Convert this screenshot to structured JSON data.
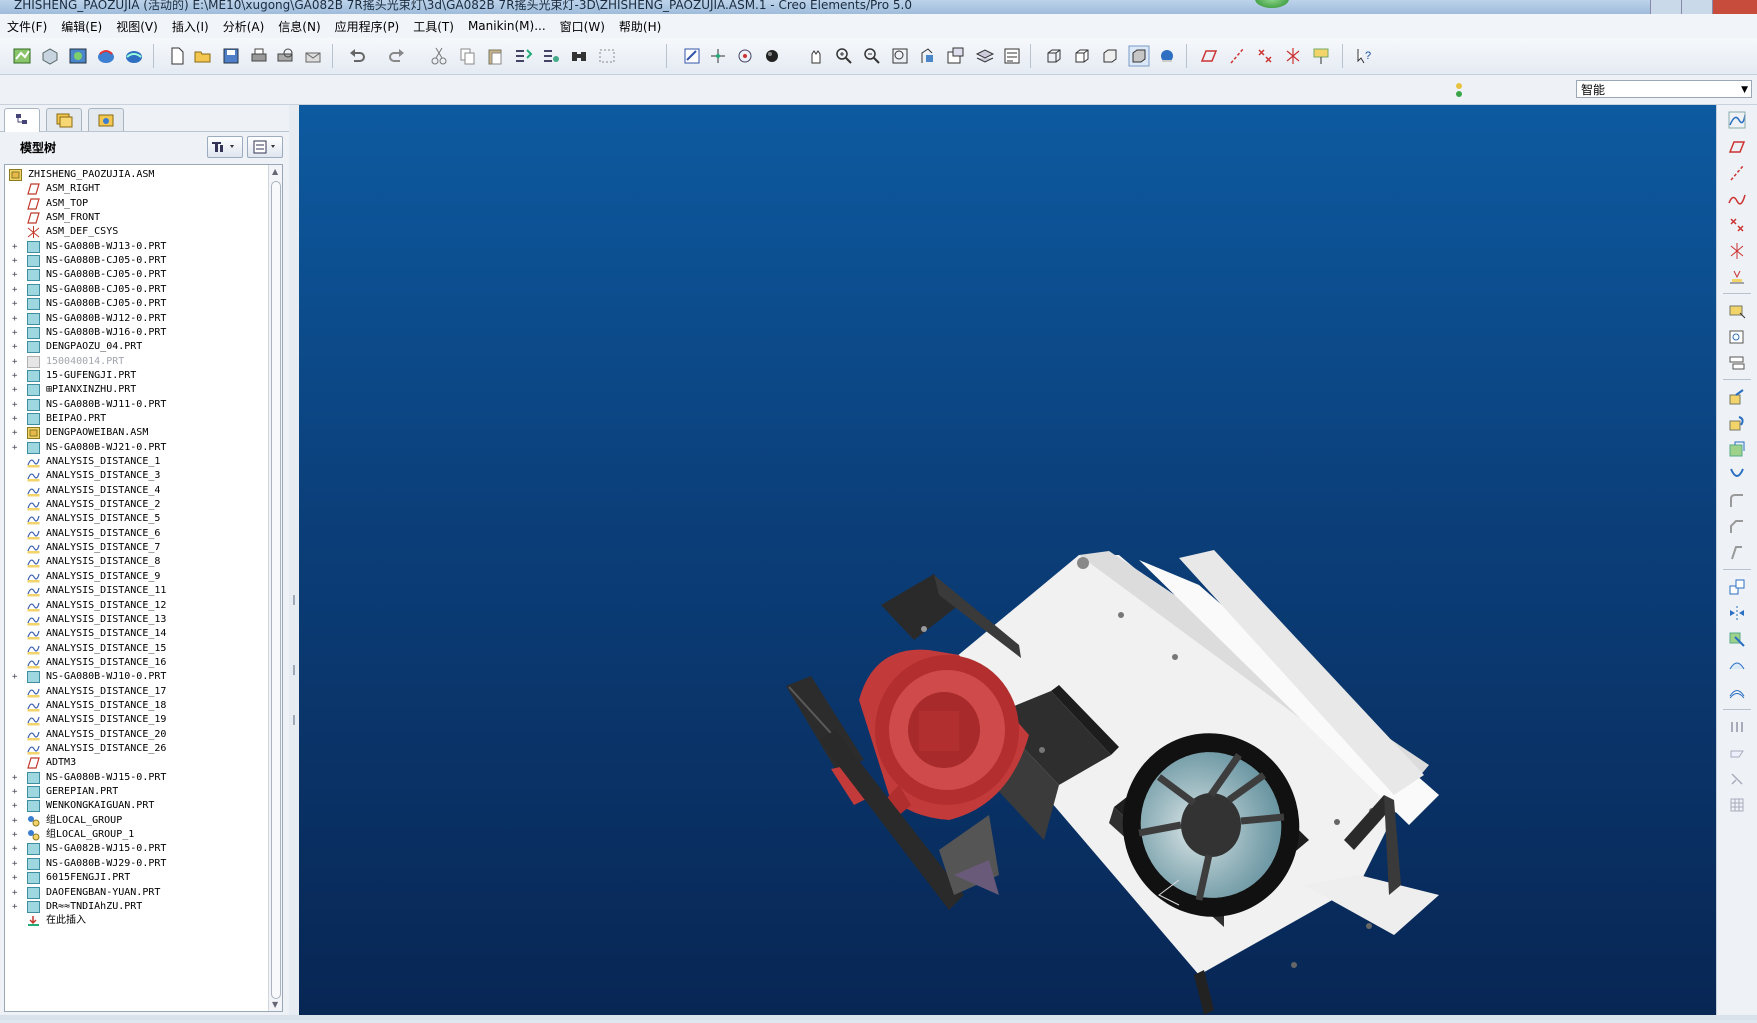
{
  "window": {
    "title": "ZHISHENG_PAOZUJIA (活动的) E:\\ME10\\xugong\\GA082B 7R搖头光束灯\\3d\\GA082B 7R搖头光束灯-3D\\ZHISHENG_PAOZUJIA.ASM.1 - Creo Elements/Pro 5.0"
  },
  "menu": {
    "items": [
      "文件(F)",
      "编辑(E)",
      "视图(V)",
      "插入(I)",
      "分析(A)",
      "信息(N)",
      "应用程序(P)",
      "工具(T)",
      "Manikin(M)...",
      "窗口(W)",
      "帮助(H)"
    ]
  },
  "toolbar2": {
    "filter_value": "智能"
  },
  "leftpanel": {
    "tree_title": "模型树"
  },
  "tree": {
    "items": [
      {
        "label": "ZHISHENG_PAOZUJIA.ASM",
        "icon": "assembly-icon",
        "expander": false,
        "root": true
      },
      {
        "label": "ASM_RIGHT",
        "icon": "datum-plane-icon",
        "expander": false
      },
      {
        "label": "ASM_TOP",
        "icon": "datum-plane-icon",
        "expander": false
      },
      {
        "label": "ASM_FRONT",
        "icon": "datum-plane-icon",
        "expander": false
      },
      {
        "label": "ASM_DEF_CSYS",
        "icon": "coordinate-system-icon",
        "expander": false
      },
      {
        "label": "NS-GA080B-WJ13-0.PRT",
        "icon": "part-icon",
        "expander": true
      },
      {
        "label": "NS-GA080B-CJ05-0.PRT",
        "icon": "part-icon",
        "expander": true
      },
      {
        "label": "NS-GA080B-CJ05-0.PRT",
        "icon": "part-icon",
        "expander": true
      },
      {
        "label": "NS-GA080B-CJ05-0.PRT",
        "icon": "part-icon",
        "expander": true
      },
      {
        "label": "NS-GA080B-CJ05-0.PRT",
        "icon": "part-icon",
        "expander": true
      },
      {
        "label": "NS-GA080B-WJ12-0.PRT",
        "icon": "part-icon",
        "expander": true
      },
      {
        "label": "NS-GA080B-WJ16-0.PRT",
        "icon": "part-icon",
        "expander": true
      },
      {
        "label": "DENGPAOZU_04.PRT",
        "icon": "part-icon",
        "expander": true
      },
      {
        "label": "150040014.PRT",
        "icon": "part-suppressed-icon",
        "expander": true,
        "grey": true
      },
      {
        "label": "15-GUFENGJI.PRT",
        "icon": "part-icon",
        "expander": true
      },
      {
        "label": "⊞PIANXINZHU.PRT",
        "icon": "part-icon",
        "expander": true
      },
      {
        "label": "NS-GA080B-WJ11-0.PRT",
        "icon": "part-icon",
        "expander": true
      },
      {
        "label": "BEIPAO.PRT",
        "icon": "part-icon",
        "expander": true
      },
      {
        "label": "DENGPAOWEIBAN.ASM",
        "icon": "assembly-icon",
        "expander": true
      },
      {
        "label": "NS-GA080B-WJ21-0.PRT",
        "icon": "part-icon",
        "expander": true
      },
      {
        "label": "ANALYSIS_DISTANCE_1",
        "icon": "analysis-icon",
        "expander": false
      },
      {
        "label": "ANALYSIS_DISTANCE_3",
        "icon": "analysis-icon",
        "expander": false
      },
      {
        "label": "ANALYSIS_DISTANCE_4",
        "icon": "analysis-icon",
        "expander": false
      },
      {
        "label": "ANALYSIS_DISTANCE_2",
        "icon": "analysis-icon",
        "expander": false
      },
      {
        "label": "ANALYSIS_DISTANCE_5",
        "icon": "analysis-icon",
        "expander": false
      },
      {
        "label": "ANALYSIS_DISTANCE_6",
        "icon": "analysis-icon",
        "expander": false
      },
      {
        "label": "ANALYSIS_DISTANCE_7",
        "icon": "analysis-icon",
        "expander": false
      },
      {
        "label": "ANALYSIS_DISTANCE_8",
        "icon": "analysis-icon",
        "expander": false
      },
      {
        "label": "ANALYSIS_DISTANCE_9",
        "icon": "analysis-icon",
        "expander": false
      },
      {
        "label": "ANALYSIS_DISTANCE_11",
        "icon": "analysis-icon",
        "expander": false
      },
      {
        "label": "ANALYSIS_DISTANCE_12",
        "icon": "analysis-icon",
        "expander": false
      },
      {
        "label": "ANALYSIS_DISTANCE_13",
        "icon": "analysis-icon",
        "expander": false
      },
      {
        "label": "ANALYSIS_DISTANCE_14",
        "icon": "analysis-icon",
        "expander": false
      },
      {
        "label": "ANALYSIS_DISTANCE_15",
        "icon": "analysis-icon",
        "expander": false
      },
      {
        "label": "ANALYSIS_DISTANCE_16",
        "icon": "analysis-icon",
        "expander": false
      },
      {
        "label": "NS-GA080B-WJ10-0.PRT",
        "icon": "part-icon",
        "expander": true
      },
      {
        "label": "ANALYSIS_DISTANCE_17",
        "icon": "analysis-icon",
        "expander": false
      },
      {
        "label": "ANALYSIS_DISTANCE_18",
        "icon": "analysis-icon",
        "expander": false
      },
      {
        "label": "ANALYSIS_DISTANCE_19",
        "icon": "analysis-icon",
        "expander": false
      },
      {
        "label": "ANALYSIS_DISTANCE_20",
        "icon": "analysis-icon",
        "expander": false
      },
      {
        "label": "ANALYSIS_DISTANCE_26",
        "icon": "analysis-icon",
        "expander": false
      },
      {
        "label": "ADTM3",
        "icon": "datum-plane-icon",
        "expander": false
      },
      {
        "label": "NS-GA080B-WJ15-0.PRT",
        "icon": "part-icon",
        "expander": true
      },
      {
        "label": "GEREPIAN.PRT",
        "icon": "part-icon",
        "expander": true
      },
      {
        "label": "WENKONGKAIGUAN.PRT",
        "icon": "part-icon",
        "expander": true
      },
      {
        "label": "组LOCAL_GROUP",
        "icon": "group-icon",
        "expander": true
      },
      {
        "label": "组LOCAL_GROUP_1",
        "icon": "group-icon",
        "expander": true
      },
      {
        "label": "NS-GA082B-WJ15-0.PRT",
        "icon": "part-icon",
        "expander": true
      },
      {
        "label": "NS-GA080B-WJ29-0.PRT",
        "icon": "part-icon",
        "expander": true
      },
      {
        "label": "6015FENGJI.PRT",
        "icon": "part-icon",
        "expander": true
      },
      {
        "label": "DAOFENGBAN-YUAN.PRT",
        "icon": "part-icon",
        "expander": true
      },
      {
        "label": "DR≈≈TNDIAhZU.PRT",
        "icon": "part-icon",
        "expander": true
      },
      {
        "label": "在此插入",
        "icon": "insert-here-icon",
        "expander": false
      }
    ]
  },
  "colors": {
    "viewport_top": "#0d5aa0",
    "viewport_bottom": "#082654",
    "fan_red": "#c43a3a",
    "part_white": "#f4f4f4",
    "part_black": "#2a2a2a"
  }
}
